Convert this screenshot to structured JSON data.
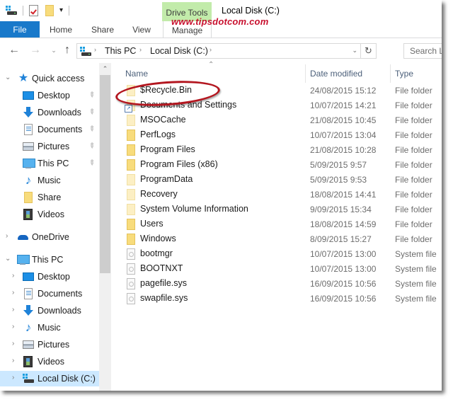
{
  "window": {
    "title": "Local Disk (C:)",
    "watermark": "www.tipsdotcom.com",
    "accent_color": "#1979ca",
    "context_tab_color": "#c2ebaa",
    "highlight_color": "#b3161f"
  },
  "quick_access_toolbar": {
    "icons": [
      "drive-icon",
      "properties-icon",
      "new-folder-icon",
      "customize-dropdown-icon"
    ],
    "dropdown_glyph": "▾"
  },
  "ribbon": {
    "context_group": "Drive Tools",
    "tabs": [
      {
        "label": "File",
        "active": true
      },
      {
        "label": "Home"
      },
      {
        "label": "Share"
      },
      {
        "label": "View"
      },
      {
        "label": "Manage"
      }
    ]
  },
  "address_bar": {
    "back_glyph": "←",
    "forward_glyph": "→",
    "recent_glyph": "⌄",
    "up_glyph": "↑",
    "breadcrumb": [
      "This PC",
      "Local Disk (C:)"
    ],
    "separator_glyph": "›",
    "dropdown_glyph": "⌄",
    "refresh_glyph": "↻",
    "search_placeholder": "Search Local Disk (C:)"
  },
  "sidebar": {
    "quick_access": {
      "label": "Quick access",
      "expanded": true,
      "items": [
        {
          "label": "Desktop",
          "icon": "desktop-icon",
          "pinned": true
        },
        {
          "label": "Downloads",
          "icon": "downloads-icon",
          "pinned": true
        },
        {
          "label": "Documents",
          "icon": "documents-icon",
          "pinned": true
        },
        {
          "label": "Pictures",
          "icon": "pictures-icon",
          "pinned": true
        },
        {
          "label": "This PC",
          "icon": "this-pc-icon",
          "pinned": true
        },
        {
          "label": "Music",
          "icon": "music-icon",
          "pinned": false
        },
        {
          "label": "Share",
          "icon": "folder-icon",
          "pinned": false
        },
        {
          "label": "Videos",
          "icon": "videos-icon",
          "pinned": false
        }
      ]
    },
    "onedrive": {
      "label": "OneDrive",
      "expanded": false
    },
    "this_pc": {
      "label": "This PC",
      "expanded": true,
      "items": [
        {
          "label": "Desktop",
          "icon": "desktop-icon"
        },
        {
          "label": "Documents",
          "icon": "documents-icon"
        },
        {
          "label": "Downloads",
          "icon": "downloads-icon"
        },
        {
          "label": "Music",
          "icon": "music-icon"
        },
        {
          "label": "Pictures",
          "icon": "pictures-icon"
        },
        {
          "label": "Videos",
          "icon": "videos-icon"
        },
        {
          "label": "Local Disk (C:)",
          "icon": "drive-icon",
          "selected": true
        }
      ]
    },
    "glyphs": {
      "expanded": "⌄",
      "collapsed": "›",
      "pin": "📌",
      "scroll_up": "⌃",
      "star": "★",
      "music": "♪"
    }
  },
  "file_list": {
    "sort_glyph": "⌃",
    "columns": [
      "Name",
      "Date modified",
      "Type"
    ],
    "rows": [
      {
        "name": "$Recycle.Bin",
        "date": "24/08/2015 15:12",
        "type": "File folder",
        "icon": "hidden-folder",
        "highlighted": true
      },
      {
        "name": "Documents and Settings",
        "date": "10/07/2015 14:21",
        "type": "File folder",
        "icon": "shortcut-folder"
      },
      {
        "name": "MSOCache",
        "date": "21/08/2015 10:45",
        "type": "File folder",
        "icon": "hidden-folder"
      },
      {
        "name": "PerfLogs",
        "date": "10/07/2015 13:04",
        "type": "File folder",
        "icon": "folder"
      },
      {
        "name": "Program Files",
        "date": "21/08/2015 10:28",
        "type": "File folder",
        "icon": "folder"
      },
      {
        "name": "Program Files (x86)",
        "date": "5/09/2015 9:57",
        "type": "File folder",
        "icon": "folder"
      },
      {
        "name": "ProgramData",
        "date": "5/09/2015 9:53",
        "type": "File folder",
        "icon": "hidden-folder"
      },
      {
        "name": "Recovery",
        "date": "18/08/2015 14:41",
        "type": "File folder",
        "icon": "hidden-folder"
      },
      {
        "name": "System Volume Information",
        "date": "9/09/2015 15:34",
        "type": "File folder",
        "icon": "hidden-folder"
      },
      {
        "name": "Users",
        "date": "18/08/2015 14:59",
        "type": "File folder",
        "icon": "folder"
      },
      {
        "name": "Windows",
        "date": "8/09/2015 15:27",
        "type": "File folder",
        "icon": "folder"
      },
      {
        "name": "bootmgr",
        "date": "10/07/2015 13:00",
        "type": "System file",
        "icon": "system-file"
      },
      {
        "name": "BOOTNXT",
        "date": "10/07/2015 13:00",
        "type": "System file",
        "icon": "system-file"
      },
      {
        "name": "pagefile.sys",
        "date": "16/09/2015 10:56",
        "type": "System file",
        "icon": "system-file"
      },
      {
        "name": "swapfile.sys",
        "date": "16/09/2015 10:56",
        "type": "System file",
        "icon": "system-file"
      }
    ]
  }
}
